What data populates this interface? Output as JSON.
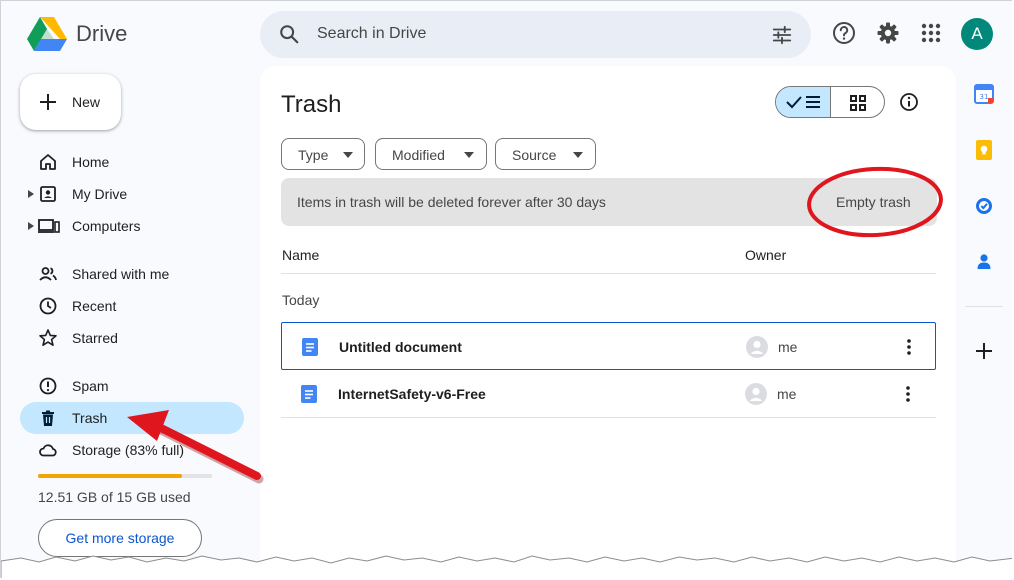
{
  "app": {
    "name": "Drive"
  },
  "search": {
    "placeholder": "Search in Drive"
  },
  "header_icons": [
    "search-icon",
    "tune-icon",
    "help-icon",
    "settings-icon",
    "apps-grid-icon"
  ],
  "account": {
    "initial": "A",
    "color": "#00897b"
  },
  "sidebar": {
    "new_label": "New",
    "items": [
      {
        "label": "Home",
        "icon": "home-icon"
      },
      {
        "label": "My Drive",
        "icon": "my-drive-icon"
      },
      {
        "label": "Computers",
        "icon": "computers-icon"
      },
      {
        "label": "Shared with me",
        "icon": "shared-icon"
      },
      {
        "label": "Recent",
        "icon": "clock-icon"
      },
      {
        "label": "Starred",
        "icon": "star-icon"
      },
      {
        "label": "Spam",
        "icon": "spam-icon"
      },
      {
        "label": "Trash",
        "icon": "trash-icon",
        "active": true
      },
      {
        "label": "Storage (83% full)",
        "icon": "cloud-icon"
      }
    ],
    "storage": {
      "used_fraction": 0.83,
      "text": "12.51 GB of 15 GB used"
    },
    "get_storage_label": "Get more storage"
  },
  "main": {
    "title": "Trash",
    "filters": [
      "Type",
      "Modified",
      "Source"
    ],
    "banner": {
      "message": "Items in trash will be deleted forever after 30 days",
      "action": "Empty trash"
    },
    "columns": {
      "name": "Name",
      "owner": "Owner"
    },
    "group_label": "Today",
    "files": [
      {
        "name": "Untitled document",
        "owner": "me",
        "selected": true
      },
      {
        "name": "InternetSafety-v6-Free",
        "owner": "me",
        "selected": false
      }
    ]
  },
  "right_rail": [
    "calendar-icon",
    "keep-icon",
    "tasks-icon",
    "contacts-icon",
    "add-icon"
  ],
  "colors": {
    "accent": "#0b57d0",
    "active_nav": "#c2e7ff",
    "storage_fill": "#f0a500",
    "annotation_red": "#e0161e",
    "doc_blue": "#4285f4"
  }
}
